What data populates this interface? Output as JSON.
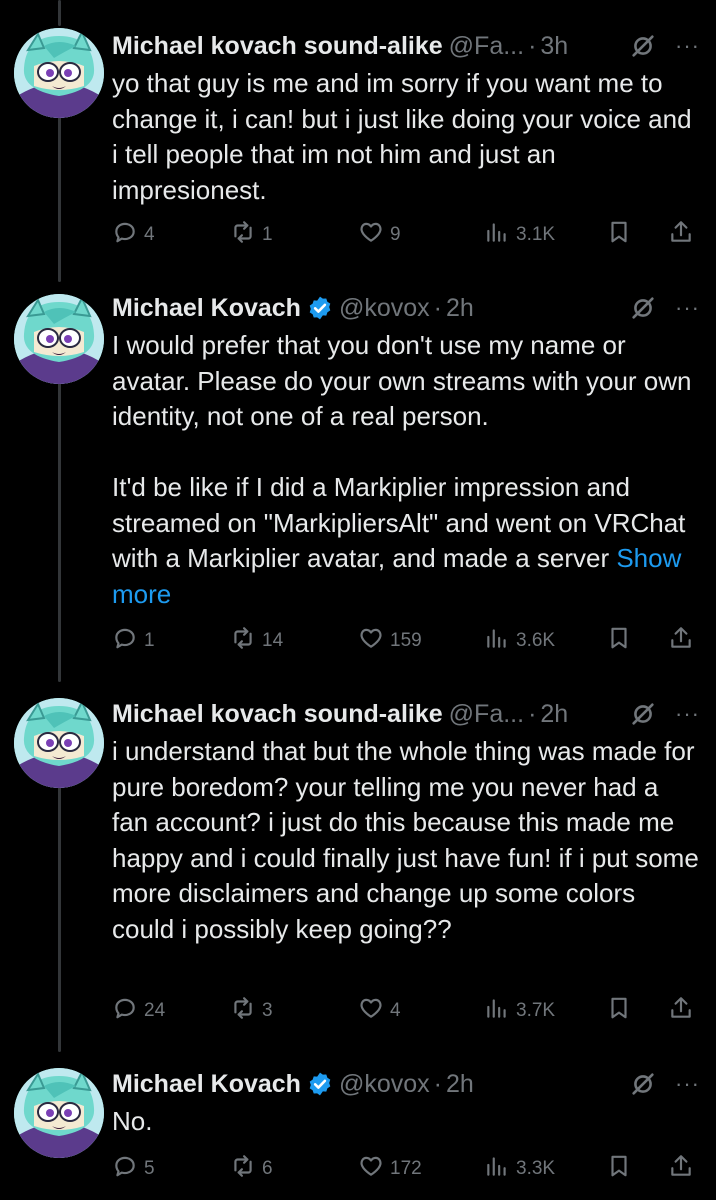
{
  "tweets": [
    {
      "name": "Michael kovach sound-alike",
      "verified": false,
      "handle": "@Fa...",
      "time": "3h",
      "text": "yo that guy is me and im sorry if you want me to change it, i can! but i just like doing your voice and i tell people that im not him and just an impresionest.",
      "show_more": "",
      "replies": "4",
      "reposts": "1",
      "likes": "9",
      "views": "3.1K"
    },
    {
      "name": "Michael Kovach",
      "verified": true,
      "handle": "@kovox",
      "time": "2h",
      "text": "I would prefer that you don't use my name or avatar. Please do your own streams with your own identity, not one of a real person.\n\nIt'd be like if I did a Markiplier impression and streamed on \"MarkipliersAlt\" and went on VRChat with a Markiplier avatar, and made a server ",
      "show_more": "Show more",
      "replies": "1",
      "reposts": "14",
      "likes": "159",
      "views": "3.6K"
    },
    {
      "name": "Michael kovach sound-alike",
      "verified": false,
      "handle": "@Fa...",
      "time": "2h",
      "text": "i understand that but the whole thing was made for pure boredom? your telling me you never had a fan account? i just do this because this made me happy and i could finally just have fun! if i put some more disclaimers and change up some colors could i possibly keep going??",
      "show_more": "",
      "replies": "24",
      "reposts": "3",
      "likes": "4",
      "views": "3.7K"
    },
    {
      "name": "Michael Kovach",
      "verified": true,
      "handle": "@kovox",
      "time": "2h",
      "text": "No.",
      "show_more": "",
      "replies": "5",
      "reposts": "6",
      "likes": "172",
      "views": "3.3K"
    }
  ],
  "separator": "·",
  "more_glyph": "···",
  "colors": {
    "background": "#000000",
    "text": "#e7e9ea",
    "muted": "#71767b",
    "link": "#1d9bf0",
    "verified": "#1d9bf0",
    "thread_line": "#333639"
  },
  "icons": [
    "reply-icon",
    "repost-icon",
    "like-icon",
    "views-icon",
    "bookmark-icon",
    "share-icon",
    "grok-icon",
    "more-icon",
    "verified-badge-icon"
  ]
}
